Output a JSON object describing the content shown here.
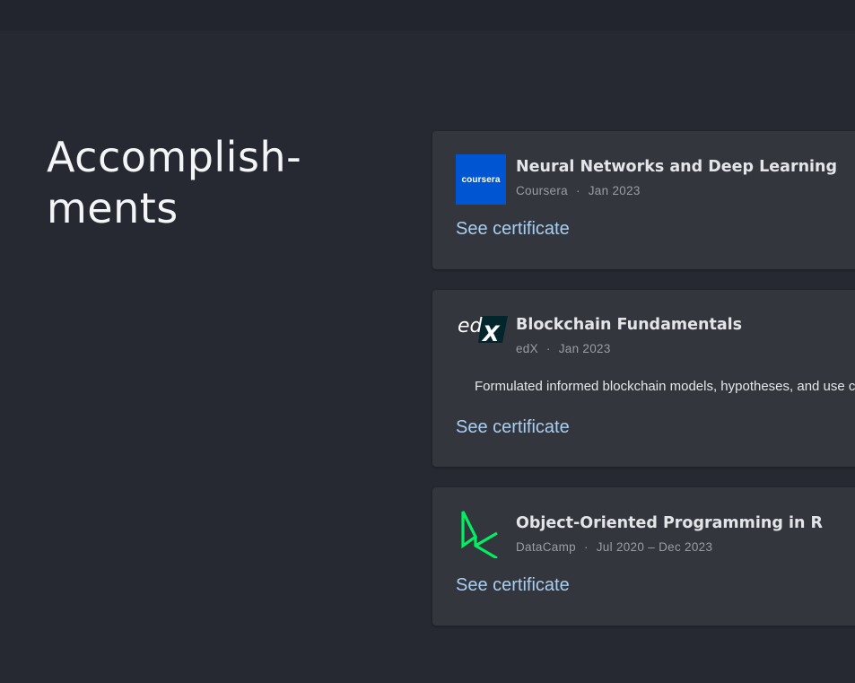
{
  "section": {
    "title_line1": "Accomplish-",
    "title_line2": "ments"
  },
  "colors": {
    "background": "#262932",
    "card": "#33363d",
    "link": "#a8cff3",
    "coursera_brand": "#0056d2",
    "datacamp_brand": "#03ef62"
  },
  "certificates": [
    {
      "title": "Neural Networks and Deep Learning",
      "issuer": "Coursera",
      "separator": "·",
      "date": "Jan 2023",
      "logo_icon": "coursera-logo-icon",
      "logo_text": "coursera",
      "link_label": "See certificate"
    },
    {
      "title": "Blockchain Fundamentals",
      "issuer": "edX",
      "separator": "·",
      "date": "Jan 2023",
      "logo_icon": "edx-logo-icon",
      "logo_text": "edX",
      "description": "Formulated informed blockchain models, hypotheses, and use cases.",
      "link_label": "See certificate"
    },
    {
      "title": "Object-Oriented Programming in R",
      "issuer": "DataCamp",
      "separator": "·",
      "date": "Jul 2020 – Dec 2023",
      "logo_icon": "datacamp-logo-icon",
      "link_label": "See certificate"
    }
  ]
}
